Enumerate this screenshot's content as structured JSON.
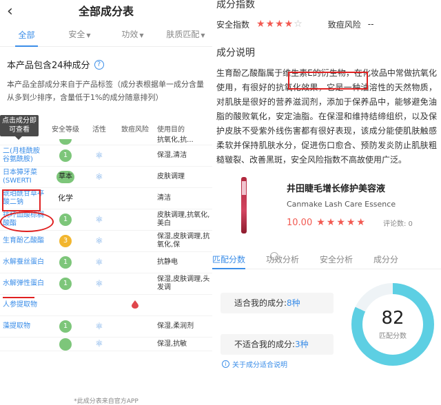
{
  "left": {
    "title": "全部成分表",
    "tabs": [
      "全部",
      "安全",
      "功效",
      "肤质匹配"
    ],
    "count_text": "本产品包含24种成分",
    "note": "本产品全部成分来自于产品标签（成分表根据单一成分含量从多到少排序，含量低于1%的成分随意排列）",
    "tooltip": "点击成分即可查看",
    "columns": [
      "安全等级",
      "活性",
      "致痘风险",
      "使用目的"
    ],
    "rows": [
      {
        "name": "",
        "safety": "",
        "use": "抗氧化,抗..."
      },
      {
        "name": "二(月桂酰胺谷氨酰胺)",
        "safety": "1",
        "use": "保湿,清洁"
      },
      {
        "name": "日本獐牙菜(SWERTI",
        "safety": "草本",
        "use": "皮肤调理"
      },
      {
        "name": "琥珀酰甘草亭酸二钠",
        "safety": "化学",
        "use": "清洁"
      },
      {
        "name": "抗坏血酸棕榈酸酯",
        "safety": "1",
        "use": "皮肤调理,抗氧化,美白"
      },
      {
        "name": "生育酚乙酸酯",
        "safety": "3",
        "use": "保湿,皮肤调理,抗氧化,保"
      },
      {
        "name": "水解蚕丝蛋白",
        "safety": "1",
        "use": "抗静电"
      },
      {
        "name": "水解弹性蛋白",
        "safety": "1",
        "use": "保湿,皮肤调理,头发调"
      },
      {
        "name": "人参提取物",
        "safety": "",
        "use": ""
      },
      {
        "name": "藻提取物",
        "safety": "1",
        "use": "保湿,柔润剂"
      },
      {
        "name": "",
        "safety": "",
        "use": "保湿,抗敏"
      }
    ],
    "footer": "*此成分表来自官方APP"
  },
  "right": {
    "index_title": "成分指数",
    "safety_label": "安全指数",
    "safety_stars": 4,
    "cancer_label": "致痘风险",
    "cancer_value": "--",
    "desc_title": "成分说明",
    "description": "生育酚乙酸酯属于维生素E的衍生物，在化妆品中常做抗氧化使用，有很好的抗氧化效果，它是一种油溶性的天然物质，对肌肤是很好的营养滋润剂，添加于保养品中，能够避免油脂的酸败氧化，安定油脂。在保湿和维持结缔组织，以及保护皮肤不受紫外线伤害都有很好表现，该成分能使肌肤触感柔软并保持肌肤水分，促进伤口愈合、预防发炎防止肌肤粗糙皲裂、改善黑斑，安全风险指数不高故使用广泛。",
    "product_name": "井田睫毛增长修护美容液",
    "product_en": "Canmake Lash Care Essence",
    "product_score": "10.00",
    "product_stars": 5,
    "review_count": "评论数: 0",
    "tabs": [
      "匹配分数",
      "功效分析",
      "安全分析",
      "成分分"
    ],
    "suitable_label": "适合我的成分:",
    "suitable_value": "8种",
    "unsuitable_label": "不适合我的成分:",
    "unsuitable_value": "3种",
    "match_score": "82",
    "match_score_fraction": 0.82,
    "match_label": "匹配分数",
    "about_link": "关于成分适合说明"
  },
  "colors": {
    "accent": "#3a8de8",
    "safe_green": "#7dc67a",
    "warn_yellow": "#f2b62f",
    "star_red": "#f25a52",
    "ring": "#5dcfe3"
  }
}
